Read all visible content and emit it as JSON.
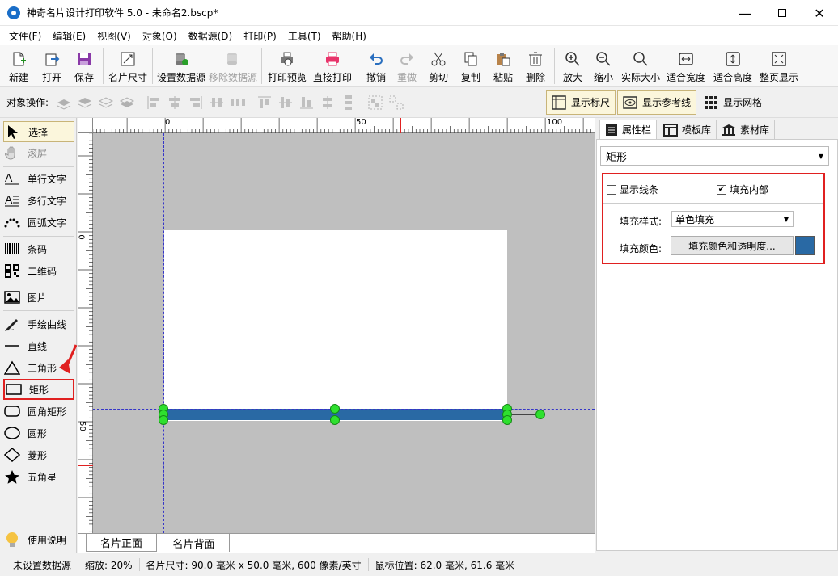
{
  "window": {
    "title": "神奇名片设计打印软件 5.0 - 未命名2.bscp*"
  },
  "menu": [
    "文件(F)",
    "编辑(E)",
    "视图(V)",
    "对象(O)",
    "数据源(D)",
    "打印(P)",
    "工具(T)",
    "帮助(H)"
  ],
  "toolbar": {
    "new": "新建",
    "open": "打开",
    "save": "保存",
    "card_size": "名片尺寸",
    "set_datasource": "设置数据源",
    "remove_datasource": "移除数据源",
    "print_preview": "打印预览",
    "direct_print": "直接打印",
    "undo": "撤销",
    "redo": "重做",
    "cut": "剪切",
    "copy": "复制",
    "paste": "粘贴",
    "delete": "删除",
    "zoom_in": "放大",
    "zoom_out": "缩小",
    "actual_size": "实际大小",
    "fit_width": "适合宽度",
    "fit_height": "适合高度",
    "fit_page": "整页显示"
  },
  "objbar": {
    "label": "对象操作:",
    "show_ruler": "显示标尺",
    "show_guides": "显示参考线",
    "show_grid": "显示网格"
  },
  "tools": {
    "select": "选择",
    "scroll": "滚屏",
    "single_text": "单行文字",
    "multi_text": "多行文字",
    "arc_text": "圆弧文字",
    "barcode": "条码",
    "qrcode": "二维码",
    "image": "图片",
    "freehand": "手绘曲线",
    "line": "直线",
    "triangle": "三角形",
    "rectangle": "矩形",
    "round_rect": "圆角矩形",
    "ellipse": "圆形",
    "diamond": "菱形",
    "star": "五角星",
    "help": "使用说明"
  },
  "ruler": {
    "top": [
      "0",
      "50",
      "100"
    ],
    "left": [
      "0",
      "50"
    ]
  },
  "bottom_tabs": {
    "front": "名片正面",
    "back": "名片背面"
  },
  "right_tabs": {
    "props": "属性栏",
    "templates": "模板库",
    "materials": "素材库"
  },
  "props": {
    "object_type": "矩形",
    "show_stroke": "显示线条",
    "show_stroke_checked": false,
    "fill_inside": "填充内部",
    "fill_inside_checked": true,
    "fill_style_label": "填充样式:",
    "fill_style_value": "单色填充",
    "fill_color_label": "填充颜色:",
    "fill_color_button": "填充颜色和透明度...",
    "fill_color": "#2969a4"
  },
  "status": {
    "datasource": "未设置数据源",
    "zoom": "缩放: 20%",
    "card_size": "名片尺寸: 90.0 毫米 x 50.0 毫米, 600 像素/英寸",
    "mouse_pos": "鼠标位置: 62.0 毫米, 61.6 毫米"
  }
}
